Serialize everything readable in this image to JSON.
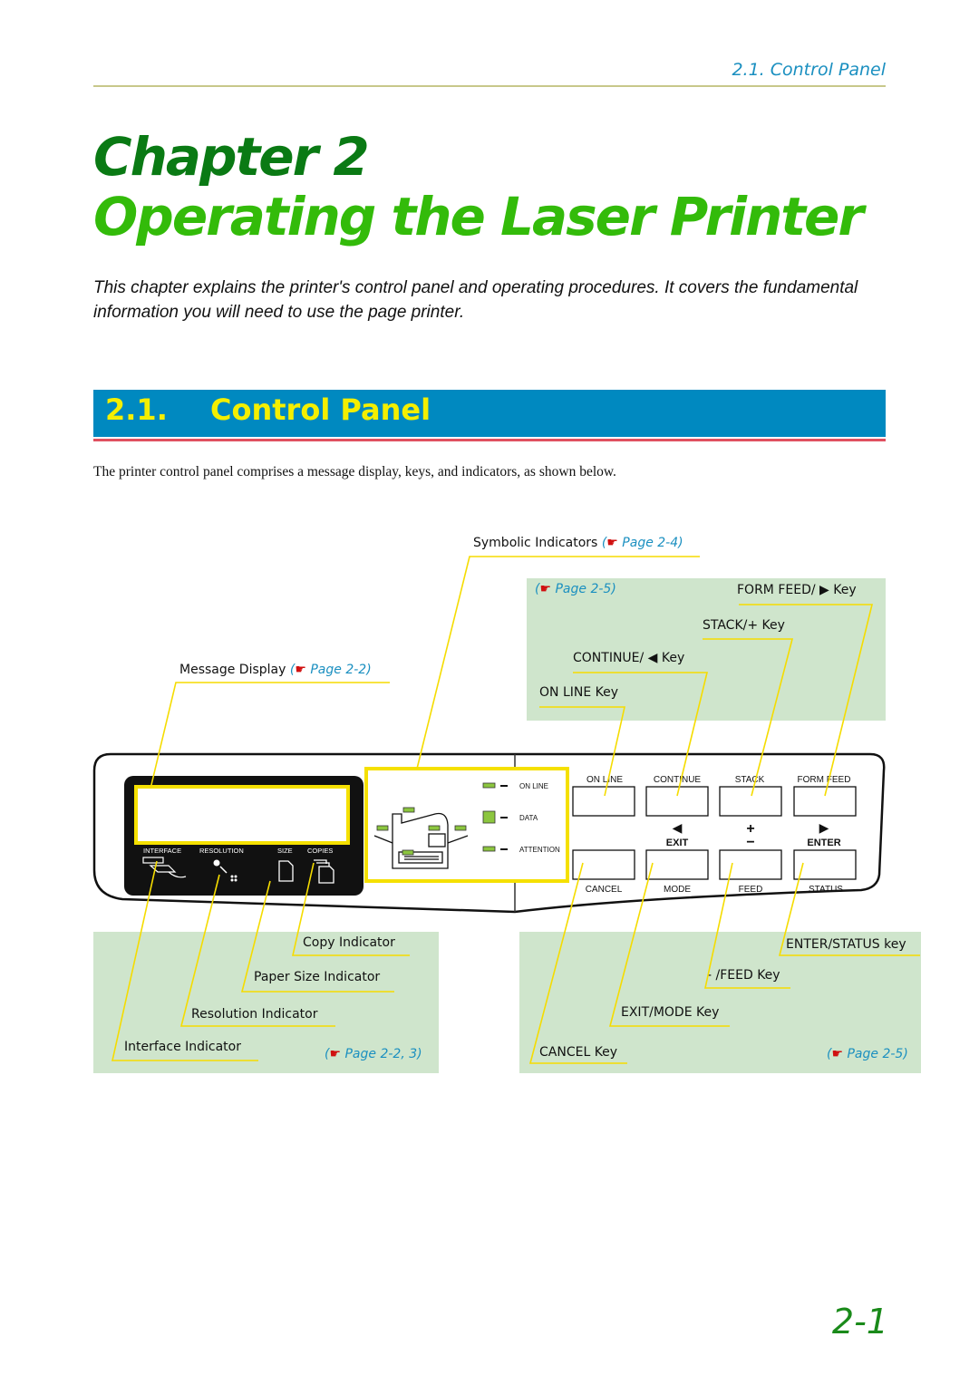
{
  "header": {
    "running_title": "2.1. Control Panel"
  },
  "chapter": {
    "label": "Chapter 2",
    "title": "Operating the Laser Printer"
  },
  "intro": "This chapter explains the printer's control panel and operating procedures. It covers the fundamental information you will need to use the page printer.",
  "section": {
    "number": "2.1.",
    "title": "Control Panel"
  },
  "body": "The printer control panel comprises a message display, keys, and indicators, as shown below.",
  "figure": {
    "callouts_top": {
      "symbolic_indicators": {
        "label": "Symbolic Indicators",
        "ref": "Page 2-4"
      },
      "message_display": {
        "label": "Message Display",
        "ref": "Page 2-2"
      },
      "keys_ref": "Page 2-5",
      "form_feed_key": "FORM FEED/ ▶ Key",
      "stack_key": "STACK/+ Key",
      "continue_key": "CONTINUE/ ◀ Key",
      "on_line_key": "ON LINE Key"
    },
    "callouts_bottom_left": {
      "copy": "Copy Indicator",
      "paper_size": "Paper Size Indicator",
      "resolution": "Resolution Indicator",
      "interface": "Interface Indicator",
      "ref": "Page 2-2, 3"
    },
    "callouts_bottom_right": {
      "enter_status": "ENTER/STATUS key",
      "feed": "- /FEED Key",
      "exit_mode": "EXIT/MODE Key",
      "cancel": "CANCEL Key",
      "ref": "Page 2-5"
    },
    "panel": {
      "display_labels": [
        "INTERFACE",
        "RESOLUTION",
        "SIZE",
        "COPIES"
      ],
      "leds": [
        "ON LINE",
        "DATA",
        "ATTENTION"
      ],
      "keys_top_labels": [
        "ON LINE",
        "CONTINUE",
        "STACK",
        "FORM FEED"
      ],
      "key_mid_labels": [
        "◀",
        "EXIT",
        "+",
        "−",
        "▶",
        "ENTER"
      ],
      "keys_bottom_labels": [
        "CANCEL",
        "MODE",
        "FEED",
        "STATUS"
      ]
    }
  },
  "hand_icon": "☛",
  "page_number": "2-1"
}
